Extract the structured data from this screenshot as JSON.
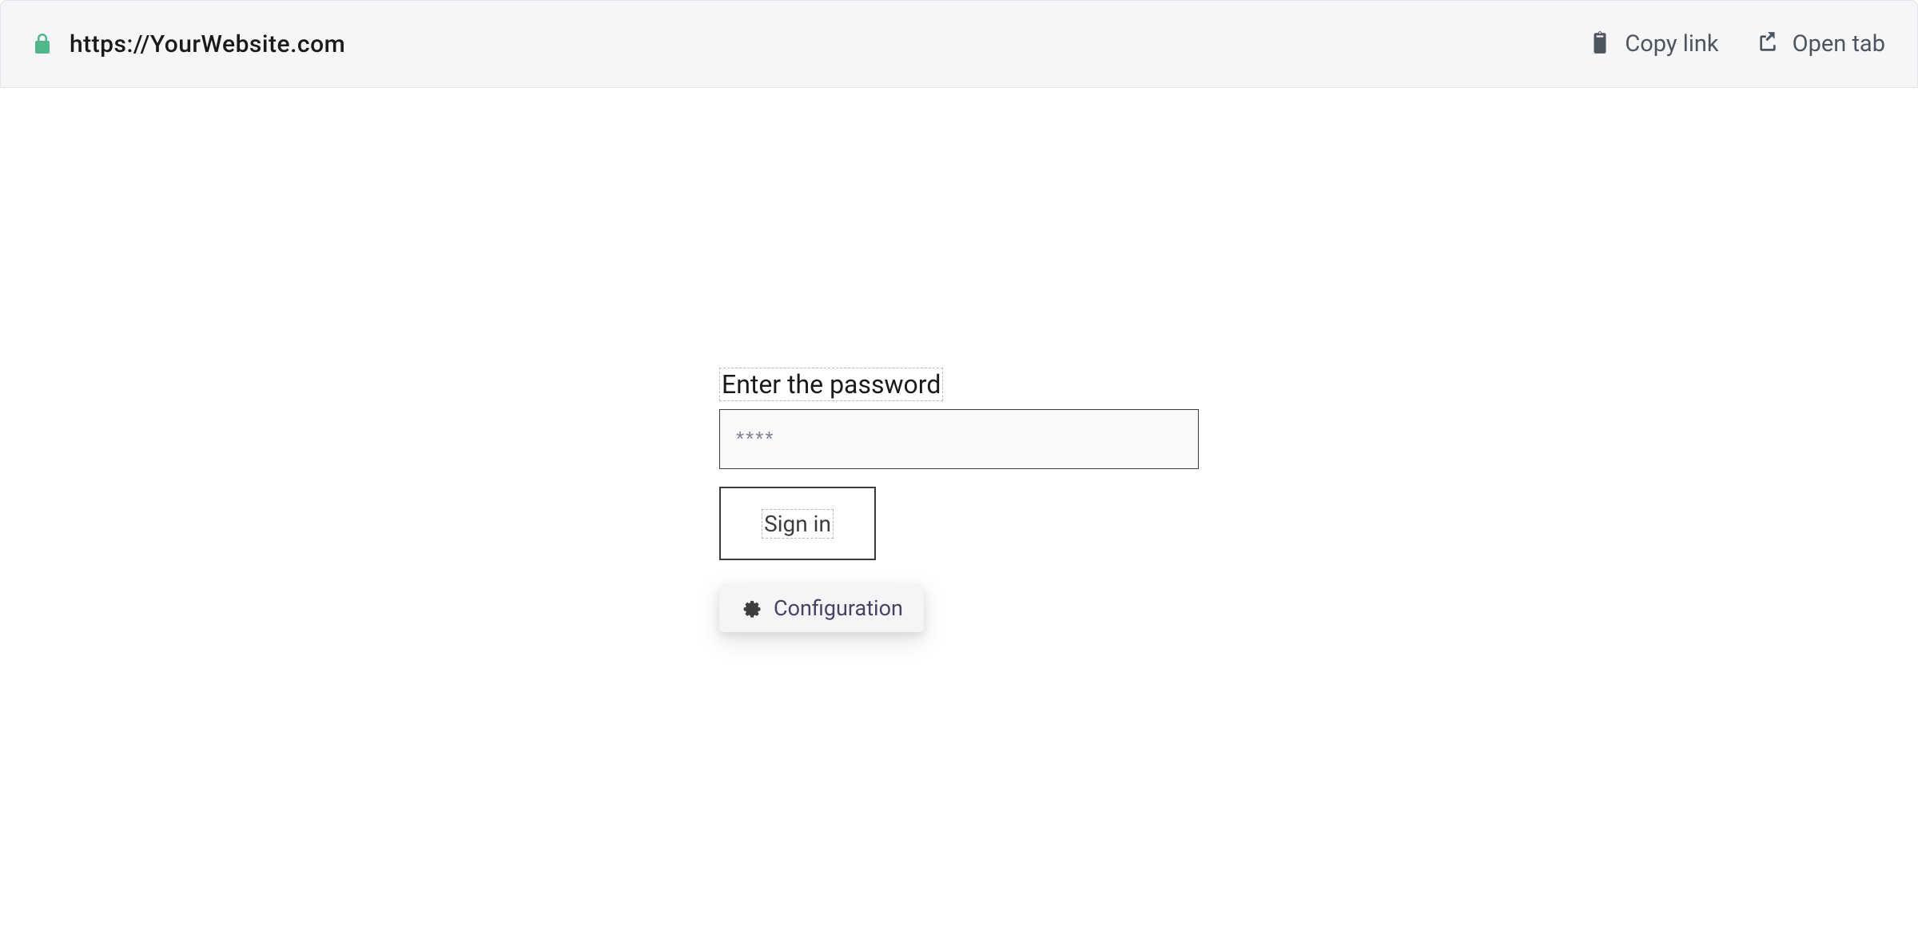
{
  "browser": {
    "url": "https://YourWebsite.com",
    "actions": {
      "copy_link": "Copy link",
      "open_tab": "Open tab"
    }
  },
  "form": {
    "password_label": "Enter the password",
    "password_placeholder": "****",
    "signin_label": "Sign in"
  },
  "toolbar": {
    "configuration_label": "Configuration"
  }
}
